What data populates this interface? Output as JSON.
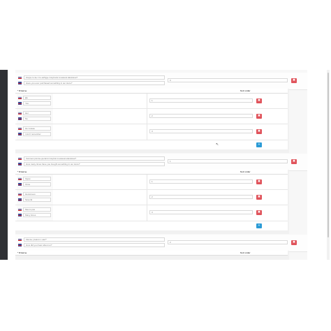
{
  "questions": [
    {
      "ru": "Когда-то вы что-нибудь покупали в нашем магазине?",
      "en": "Have you ever purchased something in our store?",
      "sort": "0",
      "answers": [
        {
          "ru": "Да",
          "en": "Yes",
          "sort": "1"
        },
        {
          "ru": "Нет",
          "en": "No",
          "sort": "2"
        },
        {
          "ru": "Не помню",
          "en": "I don't remember",
          "sort": "3"
        }
      ]
    },
    {
      "ru": "Сколько раз вы делали покупки в нашем магазине?",
      "en": "How many times have you bought something in our store?",
      "sort": "1",
      "answers": [
        {
          "ru": "Один",
          "en": "Once",
          "sort": "1"
        },
        {
          "ru": "Несколько",
          "en": "Several",
          "sort": "2"
        },
        {
          "ru": "Много раз",
          "en": "Many times",
          "sort": "3"
        }
      ]
    },
    {
      "ru": "Как вы узнали о нас?",
      "en": "How did you hear about us?",
      "sort": "2"
    }
  ],
  "labels": {
    "answers": "* Ответы",
    "sort": "Sort order"
  },
  "icons": {
    "delete": "trash-icon",
    "add": "plus-icon"
  },
  "colors": {
    "delete": "#e0535b",
    "add": "#2b9bd6",
    "sidebar": "#2f3135"
  }
}
